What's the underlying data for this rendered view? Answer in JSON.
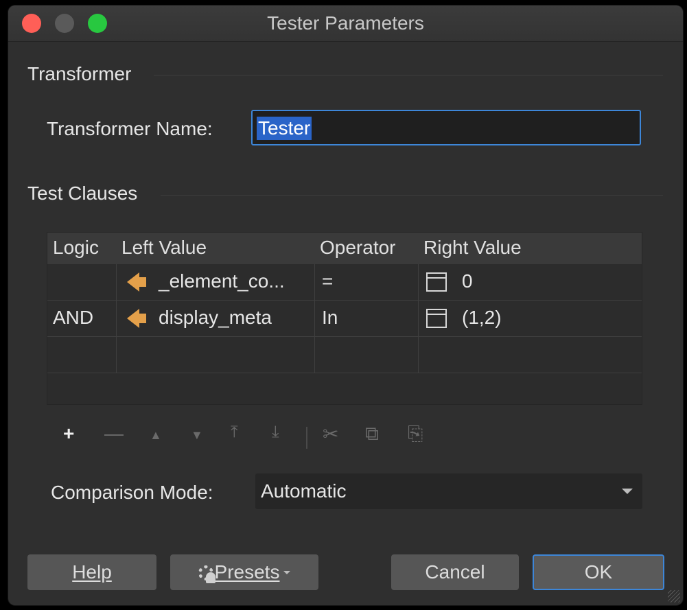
{
  "window": {
    "title": "Tester Parameters"
  },
  "transformer": {
    "section": "Transformer",
    "name_label": "Transformer Name:",
    "name_value": "Tester"
  },
  "clauses": {
    "section": "Test Clauses",
    "columns": [
      "Logic",
      "Left Value",
      "Operator",
      "Right Value"
    ],
    "rows": [
      {
        "logic": "",
        "left": "_element_co...",
        "operator": "=",
        "right": "0"
      },
      {
        "logic": "AND",
        "left": "display_meta",
        "operator": "In",
        "right": "(1,2)"
      }
    ]
  },
  "toolbar": {
    "add": "+",
    "remove": "—",
    "move_up": "▲",
    "move_down": "▼",
    "move_top": "⤒",
    "move_bottom": "⤓",
    "cut": "✂",
    "copy": "⧉",
    "paste": "⎘"
  },
  "comparison": {
    "label": "Comparison Mode:",
    "value": "Automatic"
  },
  "buttons": {
    "help": "Help",
    "presets": "Presets",
    "cancel": "Cancel",
    "ok": "OK"
  },
  "colors": {
    "accent": "#3d86d8",
    "attribute_icon": "#e4a04a",
    "window_bg": "#2f2f2f"
  }
}
